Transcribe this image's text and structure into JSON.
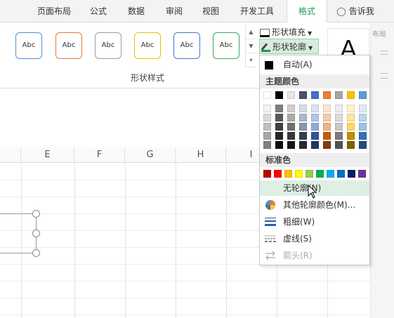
{
  "tabs": [
    {
      "label": "页面布局"
    },
    {
      "label": "公式"
    },
    {
      "label": "数据"
    },
    {
      "label": "审阅"
    },
    {
      "label": "视图"
    },
    {
      "label": "开发工具"
    },
    {
      "label": "格式",
      "active": true
    },
    {
      "label": "告诉我"
    }
  ],
  "ribbon": {
    "style_swatches": [
      "Abc",
      "Abc",
      "Abc",
      "Abc",
      "Abc",
      "Abc"
    ],
    "swatch_colors": [
      "#4a90d9",
      "#e07b39",
      "#9e9e9e",
      "#e6c200",
      "#4a74c4",
      "#3aa85c"
    ],
    "group_label": "形状样式",
    "fill_label": "形状填充",
    "outline_label": "形状轮廓",
    "big_letter": "A",
    "right_strip_text": "布局"
  },
  "sheet": {
    "columns": [
      "E",
      "F",
      "G",
      "H",
      "I"
    ]
  },
  "dropdown": {
    "auto_label": "自动(A)",
    "theme_colors_title": "主题颜色",
    "standard_colors_title": "标准色",
    "theme_top_row": [
      "#ffffff",
      "#000000",
      "#e7e6e6",
      "#44546a",
      "#4472c4",
      "#ed7d31",
      "#a5a5a5",
      "#ffc000",
      "#5b9bd5"
    ],
    "theme_shades": [
      [
        "#f2f2f2",
        "#808080",
        "#d0cece",
        "#d6dce4",
        "#d9e2f3",
        "#fbe4d5",
        "#ededed",
        "#fff2cc",
        "#deebf6"
      ],
      [
        "#d9d9d9",
        "#595959",
        "#aeaaaa",
        "#adb9ca",
        "#b4c6e7",
        "#f7cbac",
        "#dbdbdb",
        "#fee599",
        "#bdd7ee"
      ],
      [
        "#bfbfbf",
        "#404040",
        "#757070",
        "#8496b0",
        "#8eaadb",
        "#f4b183",
        "#c9c9c9",
        "#ffd965",
        "#9cc3e5"
      ],
      [
        "#a6a6a6",
        "#262626",
        "#3a3838",
        "#323f4f",
        "#2f5496",
        "#c55a11",
        "#7b7b7b",
        "#bf9000",
        "#2e75b5"
      ],
      [
        "#808080",
        "#0d0d0d",
        "#171616",
        "#222a35",
        "#1f3763",
        "#833c0b",
        "#525252",
        "#7f6000",
        "#1e4e79"
      ]
    ],
    "standard_colors": [
      "#c00000",
      "#ff0000",
      "#ffc000",
      "#ffff00",
      "#92d050",
      "#00b050",
      "#00b0f0",
      "#0070c0",
      "#002060",
      "#7030a0"
    ],
    "no_outline_label": "无轮廓(N)",
    "more_colors_label": "其他轮廓颜色(M)...",
    "weight_label": "粗细(W)",
    "dash_label": "虚线(S)",
    "arrow_label": "箭头(R)"
  }
}
